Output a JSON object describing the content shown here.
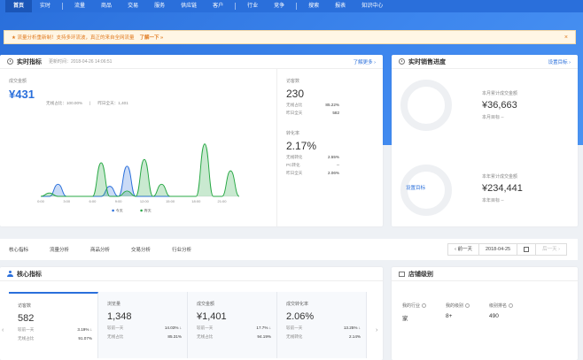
{
  "nav": {
    "items": [
      "首页",
      "实时",
      "流量",
      "商品",
      "交易",
      "服务",
      "供应链",
      "客户",
      "行业",
      "竞争",
      "搜索",
      "报表",
      "知识中心"
    ]
  },
  "notice": {
    "text": "★ 流量分析重新制！支持多环流波，真正的来自全网流量",
    "link": "了解一下 »",
    "close": "×"
  },
  "realtime": {
    "title": "实时指标",
    "updated": "更新时间：2018-04-26 14:06:51",
    "more": "了解更多 ›",
    "pay_label": "成交金额",
    "pay_value": "¥431",
    "mini": [
      "无线占比：100.00%",
      "|",
      "昨日全天：1,401"
    ],
    "visitors_label": "访客数",
    "visitors_value": "230",
    "visitors_rows": [
      [
        "无线占比",
        "85.22%"
      ],
      [
        "昨日全天",
        "582"
      ]
    ],
    "conv_label": "转化率",
    "conv_value": "2.17%",
    "conv_rows": [
      [
        "无线转化",
        "2.55%"
      ],
      [
        "PC转化",
        "--"
      ],
      [
        "昨日全天",
        "2.06%"
      ]
    ]
  },
  "chart_data": {
    "type": "area",
    "categories": [
      "0:00",
      "3:00",
      "6:00",
      "9:00",
      "12:00",
      "15:00",
      "18:00",
      "21:00"
    ],
    "series": [
      {
        "name": "今天",
        "color": "#2a6fdb",
        "x": [
          0,
          1,
          2,
          3,
          4,
          5,
          6,
          7,
          8,
          9,
          10,
          11,
          12,
          13,
          14,
          15
        ],
        "values": [
          0,
          0,
          0.18,
          0,
          0,
          0,
          0,
          0,
          0.15,
          0,
          0.45,
          0,
          0,
          0,
          0,
          0
        ]
      },
      {
        "name": "昨天",
        "color": "#27a844",
        "x": [
          0,
          1,
          2,
          3,
          4,
          5,
          6,
          7,
          8,
          9,
          10,
          11,
          12,
          13,
          14,
          15,
          16,
          17,
          18,
          19,
          20,
          21,
          22,
          23
        ],
        "values": [
          0,
          0.05,
          0,
          0,
          0,
          0,
          0,
          0.5,
          0,
          0,
          0.08,
          0,
          0.55,
          0,
          0.18,
          0,
          0,
          0,
          0,
          0.78,
          0,
          0,
          0.38,
          0
        ]
      }
    ],
    "legend": [
      "今天",
      "昨天"
    ],
    "legend_position": "bottom"
  },
  "sales": {
    "title": "实时销售进度",
    "link": "设置目标 ›",
    "month_label": "本月累计成交金额",
    "month_value": "¥36,663",
    "month_target": "本月目标 --",
    "year_label": "本年累计成交金额",
    "year_value": "¥234,441",
    "year_target": "本年目标 --",
    "target_button": "设置目标"
  },
  "tabs": {
    "items": [
      "核心指标",
      "流量分析",
      "商品分析",
      "交易分析",
      "行业分析"
    ],
    "prev": "‹ 前一天",
    "date": "2018-04-25",
    "next": "后一天 ›"
  },
  "core": {
    "title": "核心指标",
    "left_arrow": "‹",
    "right_arrow": "›",
    "metrics": [
      {
        "label": "访客数",
        "value": "582",
        "r1": [
          "较前一天",
          "3.19% ↓"
        ],
        "r2": [
          "无线占比",
          "91.07%"
        ]
      },
      {
        "label": "浏览量",
        "value": "1,348",
        "r1": [
          "较前一天",
          "14.03% ↓"
        ],
        "r2": [
          "无线占比",
          "85.31%"
        ]
      },
      {
        "label": "成交金额",
        "value": "¥1,401",
        "r1": [
          "较前一天",
          "17.7% ↓"
        ],
        "r2": [
          "无线占比",
          "94.19%"
        ]
      },
      {
        "label": "成交转化率",
        "value": "2.06%",
        "r1": [
          "较前一天",
          "13.25% ↓"
        ],
        "r2": [
          "无线转化",
          "2.14%"
        ]
      }
    ]
  },
  "store": {
    "title": "店铺级别",
    "cols": [
      {
        "label": "我的行业",
        "value": "家"
      },
      {
        "label": "我的级别",
        "value": "8+"
      },
      {
        "label": "级别排名",
        "value": "490"
      }
    ]
  }
}
